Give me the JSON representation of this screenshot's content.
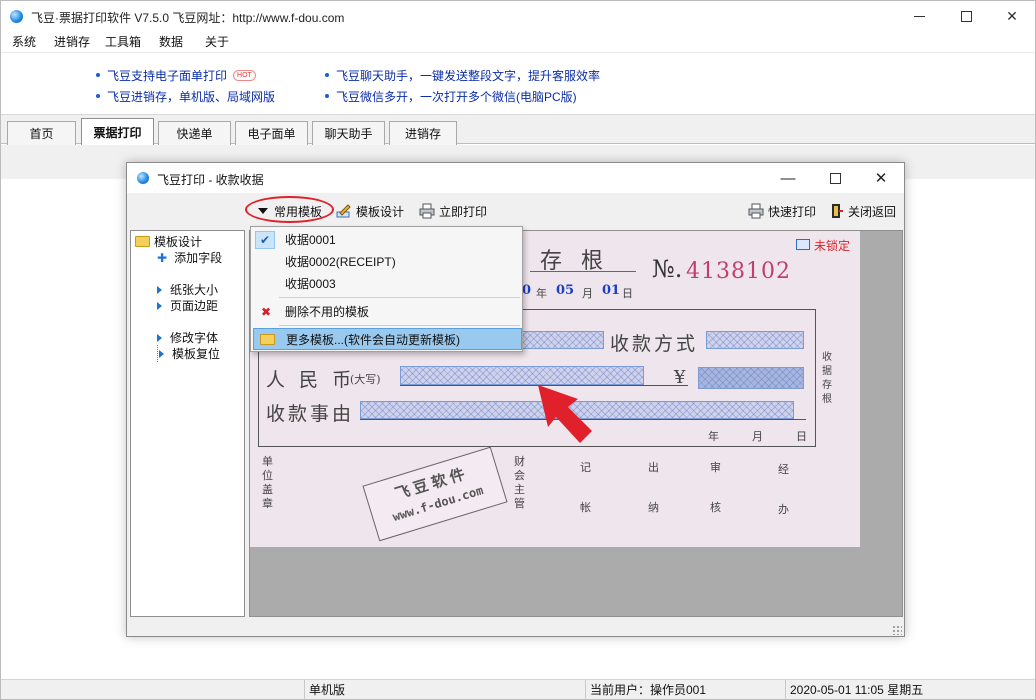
{
  "window": {
    "title": "飞豆·票据打印软件 V7.5.0   飞豆网址：http://www.f-dou.com",
    "controls": {
      "minimize": "—",
      "maximize": "☐",
      "close": "✕"
    }
  },
  "menu": [
    "系统",
    "进销存",
    "工具箱",
    "数据",
    "关于"
  ],
  "promo": {
    "links": [
      "飞豆支持电子面单打印",
      "飞豆进销存，单机版、局域网版",
      "飞豆聊天助手，一键发送整段文字，提升客服效率",
      "飞豆微信多开，一次打开多个微信(电脑PC版)"
    ],
    "hot_badge": "HOT"
  },
  "tabs": [
    {
      "label": "首页",
      "active": false
    },
    {
      "label": "票据打印",
      "active": true
    },
    {
      "label": "快递单",
      "active": false
    },
    {
      "label": "电子面单",
      "active": false
    },
    {
      "label": "聊天助手",
      "active": false
    },
    {
      "label": "进销存",
      "active": false
    }
  ],
  "dialog": {
    "title": "飞豆打印 - 收款收据",
    "controls": {
      "minimize": "—",
      "maximize": "☐",
      "close": "✕"
    },
    "toolbar": {
      "templates": "常用模板",
      "design": "模板设计",
      "print_now": "立即打印",
      "quick_print": "快速打印",
      "close_return": "关闭返回"
    },
    "tree": {
      "root": "模板设计",
      "items": [
        "添加字段",
        "纸张大小",
        "页面边距",
        "修改字体",
        "模板复位"
      ]
    },
    "dropdown": {
      "items": [
        "收据0001",
        "收据0002(RECEIPT)",
        "收据0003",
        "删除不用的模板",
        "更多模板...(软件会自动更新模板)"
      ]
    },
    "receipt": {
      "heading": "存 根",
      "no_prefix": "№.",
      "number": "4138102",
      "date_year_suffix": "0",
      "year_label": "年",
      "month": "05",
      "month_label": "月",
      "day": "01",
      "day_label": "日",
      "payment_method": "收款方式",
      "rmb": "人 民 币",
      "daxie": "(大写)",
      "yen": "¥",
      "reason": "收款事由",
      "date_row": [
        "年",
        "月",
        "日"
      ],
      "side_label": "收\n据\n存\n根",
      "unlock": "未锁定",
      "footer": [
        "单\n位\n盖\n章",
        "财\n会\n主\n管",
        "记",
        "出",
        "审",
        "经",
        "帐",
        "纳",
        "核",
        "办"
      ],
      "stamp_line1": "飞豆软件",
      "stamp_line2": "www.f-dou.com"
    }
  },
  "status": {
    "mode": "单机版",
    "user": "当前用户：操作员001",
    "datetime": "2020-05-01 11:05 星期五"
  },
  "colors": {
    "accent": "#1a73d9",
    "red": "#e0202a",
    "highlight": "#99c9ef"
  }
}
